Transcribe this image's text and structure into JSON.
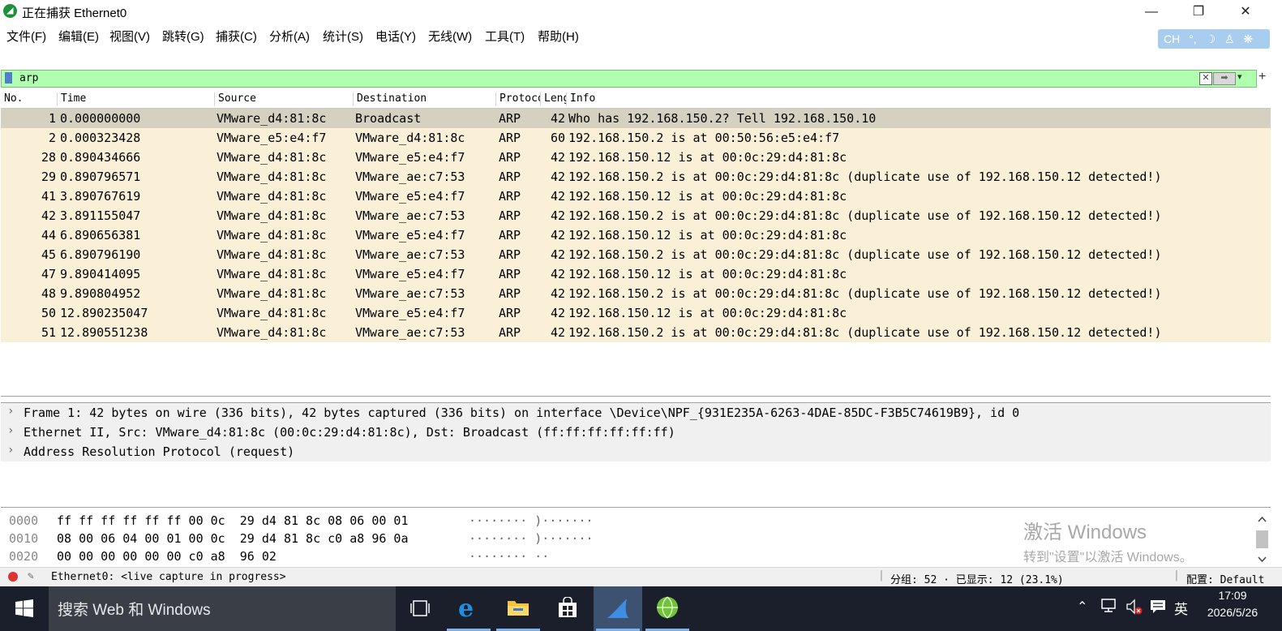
{
  "window": {
    "title": "正在捕获 Ethernet0"
  },
  "menu": [
    "文件(F)",
    "编辑(E)",
    "视图(V)",
    "跳转(G)",
    "捕获(C)",
    "分析(A)",
    "统计(S)",
    "电话(Y)",
    "无线(W)",
    "工具(T)",
    "帮助(H)"
  ],
  "ime": {
    "lang": "CH"
  },
  "toolbar_icons": [
    "shark-fin-start-icon",
    "stop-capture-icon",
    "restart-capture-icon",
    "capture-options-icon",
    "open-file-icon",
    "save-file-icon",
    "close-file-icon",
    "reload-file-icon",
    "find-packet-icon",
    "go-back-icon",
    "go-forward-icon",
    "go-to-packet-icon",
    "first-packet-icon",
    "last-packet-icon",
    "auto-scroll-icon",
    "colorize-icon",
    "zoom-in-icon",
    "zoom-out-icon",
    "normal-size-icon",
    "resize-columns-icon"
  ],
  "filter": {
    "value": "arp",
    "plus": "+"
  },
  "packet_list": {
    "columns": [
      "No.",
      "Time",
      "Source",
      "Destination",
      "Protocol",
      "Length",
      "Info"
    ],
    "rows": [
      {
        "no": "1",
        "time": "0.000000000",
        "src": "VMware_d4:81:8c",
        "dst": "Broadcast",
        "proto": "ARP",
        "len": "42",
        "info": "Who has 192.168.150.2? Tell 192.168.150.10"
      },
      {
        "no": "2",
        "time": "0.000323428",
        "src": "VMware_e5:e4:f7",
        "dst": "VMware_d4:81:8c",
        "proto": "ARP",
        "len": "60",
        "info": "192.168.150.2 is at 00:50:56:e5:e4:f7"
      },
      {
        "no": "28",
        "time": "0.890434666",
        "src": "VMware_d4:81:8c",
        "dst": "VMware_e5:e4:f7",
        "proto": "ARP",
        "len": "42",
        "info": "192.168.150.12 is at 00:0c:29:d4:81:8c"
      },
      {
        "no": "29",
        "time": "0.890796571",
        "src": "VMware_d4:81:8c",
        "dst": "VMware_ae:c7:53",
        "proto": "ARP",
        "len": "42",
        "info": "192.168.150.2 is at 00:0c:29:d4:81:8c (duplicate use of 192.168.150.12 detected!)"
      },
      {
        "no": "41",
        "time": "3.890767619",
        "src": "VMware_d4:81:8c",
        "dst": "VMware_e5:e4:f7",
        "proto": "ARP",
        "len": "42",
        "info": "192.168.150.12 is at 00:0c:29:d4:81:8c"
      },
      {
        "no": "42",
        "time": "3.891155047",
        "src": "VMware_d4:81:8c",
        "dst": "VMware_ae:c7:53",
        "proto": "ARP",
        "len": "42",
        "info": "192.168.150.2 is at 00:0c:29:d4:81:8c (duplicate use of 192.168.150.12 detected!)"
      },
      {
        "no": "44",
        "time": "6.890656381",
        "src": "VMware_d4:81:8c",
        "dst": "VMware_e5:e4:f7",
        "proto": "ARP",
        "len": "42",
        "info": "192.168.150.12 is at 00:0c:29:d4:81:8c"
      },
      {
        "no": "45",
        "time": "6.890796190",
        "src": "VMware_d4:81:8c",
        "dst": "VMware_ae:c7:53",
        "proto": "ARP",
        "len": "42",
        "info": "192.168.150.2 is at 00:0c:29:d4:81:8c (duplicate use of 192.168.150.12 detected!)"
      },
      {
        "no": "47",
        "time": "9.890414095",
        "src": "VMware_d4:81:8c",
        "dst": "VMware_e5:e4:f7",
        "proto": "ARP",
        "len": "42",
        "info": "192.168.150.12 is at 00:0c:29:d4:81:8c"
      },
      {
        "no": "48",
        "time": "9.890804952",
        "src": "VMware_d4:81:8c",
        "dst": "VMware_ae:c7:53",
        "proto": "ARP",
        "len": "42",
        "info": "192.168.150.2 is at 00:0c:29:d4:81:8c (duplicate use of 192.168.150.12 detected!)"
      },
      {
        "no": "50",
        "time": "12.890235047",
        "src": "VMware_d4:81:8c",
        "dst": "VMware_e5:e4:f7",
        "proto": "ARP",
        "len": "42",
        "info": "192.168.150.12 is at 00:0c:29:d4:81:8c"
      },
      {
        "no": "51",
        "time": "12.890551238",
        "src": "VMware_d4:81:8c",
        "dst": "VMware_ae:c7:53",
        "proto": "ARP",
        "len": "42",
        "info": "192.168.150.2 is at 00:0c:29:d4:81:8c (duplicate use of 192.168.150.12 detected!)"
      }
    ]
  },
  "details": [
    "Frame 1: 42 bytes on wire (336 bits), 42 bytes captured (336 bits) on interface \\Device\\NPF_{931E235A-6263-4DAE-85DC-F3B5C74619B9}, id 0",
    "Ethernet II, Src: VMware_d4:81:8c (00:0c:29:d4:81:8c), Dst: Broadcast (ff:ff:ff:ff:ff:ff)",
    "Address Resolution Protocol (request)"
  ],
  "bytes": [
    {
      "offset": "0000",
      "hex": "ff ff ff ff ff ff 00 0c  29 d4 81 8c 08 06 00 01",
      "ascii": "········ )·······"
    },
    {
      "offset": "0010",
      "hex": "08 00 06 04 00 01 00 0c  29 d4 81 8c c0 a8 96 0a",
      "ascii": "········ )·······"
    },
    {
      "offset": "0020",
      "hex": "00 00 00 00 00 00 c0 a8  96 02",
      "ascii": "········ ··"
    }
  ],
  "watermark": {
    "line1": "激活 Windows",
    "line2": "转到\"设置\"以激活 Windows。"
  },
  "status": {
    "capture": "Ethernet0: <live capture in progress>",
    "packets": "分组: 52 · 已显示: 12 (23.1%)",
    "profile": "配置: Default"
  },
  "taskbar": {
    "search": "搜索 Web 和 Windows",
    "ime": "英",
    "time": "17:09",
    "date": "2026/5/26"
  }
}
